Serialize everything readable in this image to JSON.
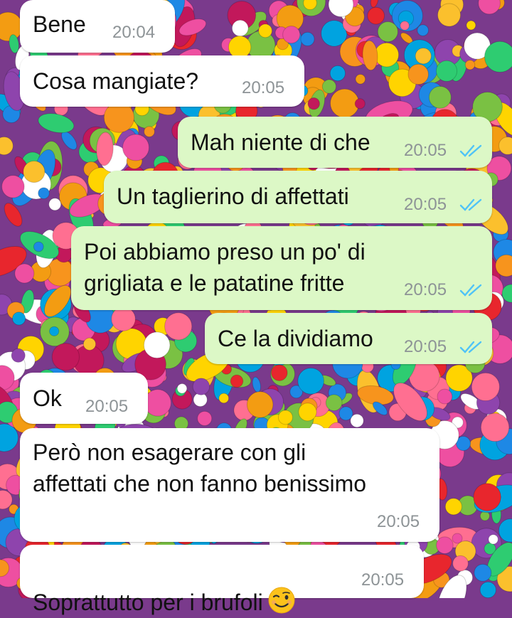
{
  "colors": {
    "incoming_bubble": "#ffffff",
    "outgoing_bubble": "#dcf8c6",
    "read_ticks": "#4fc3f7",
    "timestamp": "#8d9396"
  },
  "messages": [
    {
      "text": "Bene",
      "time": "20:04",
      "direction": "incoming"
    },
    {
      "text": "Cosa mangiate?",
      "time": "20:05",
      "direction": "incoming"
    },
    {
      "text": "Mah niente di che",
      "time": "20:05",
      "direction": "outgoing",
      "status": "read"
    },
    {
      "text": "Un taglierino di affettati",
      "time": "20:05",
      "direction": "outgoing",
      "status": "read"
    },
    {
      "text": "Poi abbiamo preso un po' di\ngrigliata e le patatine fritte",
      "time": "20:05",
      "direction": "outgoing",
      "status": "read"
    },
    {
      "text": "Ce la dividiamo",
      "time": "20:05",
      "direction": "outgoing",
      "status": "read"
    },
    {
      "text": "Ok",
      "time": "20:05",
      "direction": "incoming"
    },
    {
      "text": "Però non esagerare con gli\naffettati che non fanno benissimo",
      "time": "20:05",
      "direction": "incoming"
    },
    {
      "text": "Soprattutto per i brufoli",
      "time": "20:05",
      "direction": "incoming",
      "emoji": "winking-face-icon"
    }
  ]
}
